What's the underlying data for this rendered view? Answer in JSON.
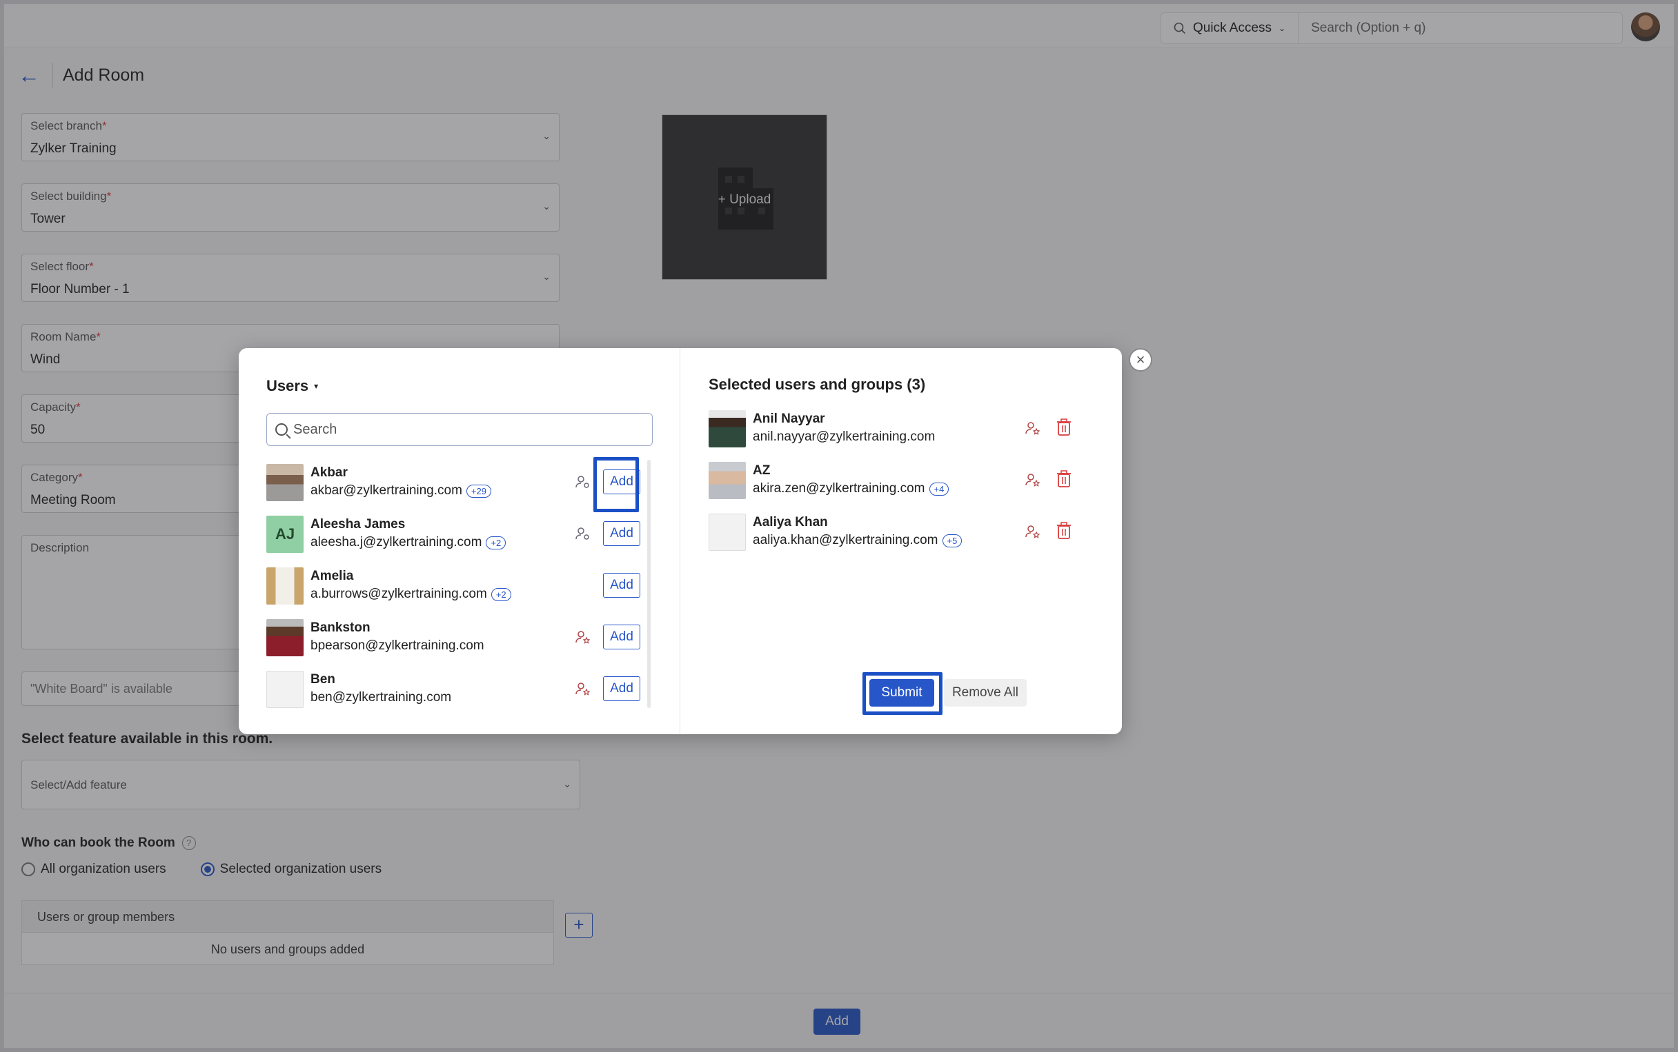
{
  "topbar": {
    "quick_access": "Quick Access",
    "search_placeholder": "Search (Option + q)"
  },
  "header": {
    "title": "Add Room"
  },
  "form": {
    "branch": {
      "label": "Select branch",
      "value": "Zylker Training"
    },
    "building": {
      "label": "Select building",
      "value": "Tower"
    },
    "floor": {
      "label": "Select floor",
      "value": "Floor Number - 1"
    },
    "room_name": {
      "label": "Room Name",
      "value": "Wind"
    },
    "capacity": {
      "label": "Capacity",
      "value": "50"
    },
    "category": {
      "label": "Category",
      "value": "Meeting Room"
    },
    "description": {
      "label": "Description"
    },
    "whiteboard_hint": "\"White Board\" is available",
    "feature_title": "Select feature available in this room.",
    "feature_placeholder": "Select/Add feature",
    "who_title": "Who can book the Room",
    "radio_all": "All organization users",
    "radio_selected": "Selected organization users",
    "members_header": "Users or group members",
    "members_empty": "No users and groups added",
    "upload_label": "+ Upload",
    "add_button": "Add"
  },
  "modal": {
    "users_dropdown": "Users",
    "search_placeholder": "Search",
    "add_label": "Add",
    "users": [
      {
        "name": "Akbar",
        "email": "akbar@zylkertraining.com",
        "badge": "+29",
        "initials": ""
      },
      {
        "name": "Aleesha James",
        "email": "aleesha.j@zylkertraining.com",
        "badge": "+2",
        "initials": "AJ"
      },
      {
        "name": "Amelia",
        "email": "a.burrows@zylkertraining.com",
        "badge": "+2",
        "initials": ""
      },
      {
        "name": "Bankston",
        "email": "bpearson@zylkertraining.com",
        "badge": "",
        "initials": ""
      },
      {
        "name": "Ben",
        "email": "ben@zylkertraining.com",
        "badge": "",
        "initials": ""
      }
    ],
    "selected_title": "Selected users and groups (3)",
    "selected": [
      {
        "name": "Anil Nayyar",
        "email": "anil.nayyar@zylkertraining.com",
        "badge": ""
      },
      {
        "name": "AZ",
        "email": "akira.zen@zylkertraining.com",
        "badge": "+4"
      },
      {
        "name": "Aaliya Khan",
        "email": "aaliya.khan@zylkertraining.com",
        "badge": "+5"
      }
    ],
    "submit": "Submit",
    "remove_all": "Remove All"
  },
  "colors": {
    "accent": "#2756c9",
    "highlight": "#1a4fc6",
    "danger": "#d83b3b"
  }
}
